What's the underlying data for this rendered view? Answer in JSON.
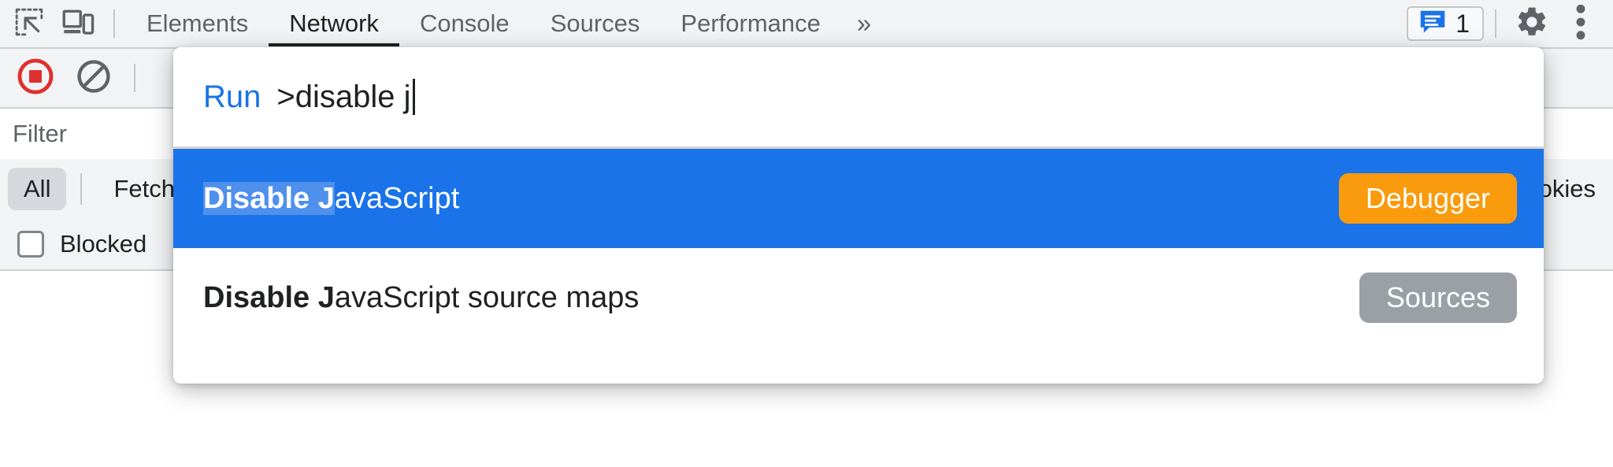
{
  "toolbar": {
    "inspect_icon": "inspect-element-icon",
    "device_icon": "device-toolbar-icon",
    "tabs": [
      {
        "label": "Elements",
        "active": false
      },
      {
        "label": "Network",
        "active": true
      },
      {
        "label": "Console",
        "active": false
      },
      {
        "label": "Sources",
        "active": false
      },
      {
        "label": "Performance",
        "active": false
      }
    ],
    "more_tabs_glyph": "»",
    "issues_count": "1",
    "issues_icon": "issues-message-icon",
    "settings_icon": "gear-icon",
    "more_options_icon": "vertical-dots-icon",
    "accent_blue": "#1a73e8",
    "record_red": "#e02f2f"
  },
  "network": {
    "record_icon": "record-stop-icon",
    "clear_icon": "clear-network-log-icon",
    "filter_placeholder": "Filter",
    "filter_value": "",
    "types": [
      {
        "label": "All",
        "selected": true
      },
      {
        "label": "Fetch",
        "selected": false
      },
      {
        "label": "Cookies",
        "selected": false
      }
    ],
    "blocked_label": "Blocked",
    "blocked_checked": false
  },
  "palette": {
    "prefix": "Run",
    "query": ">disable j",
    "items": [
      {
        "match": "Disable J",
        "rest": "avaScript",
        "badge": "Debugger",
        "badge_color": "#f99b0c",
        "selected": true
      },
      {
        "match": "Disable J",
        "rest": "avaScript source maps",
        "badge": "Sources",
        "badge_color": "#9aa0a6",
        "selected": false
      }
    ]
  }
}
